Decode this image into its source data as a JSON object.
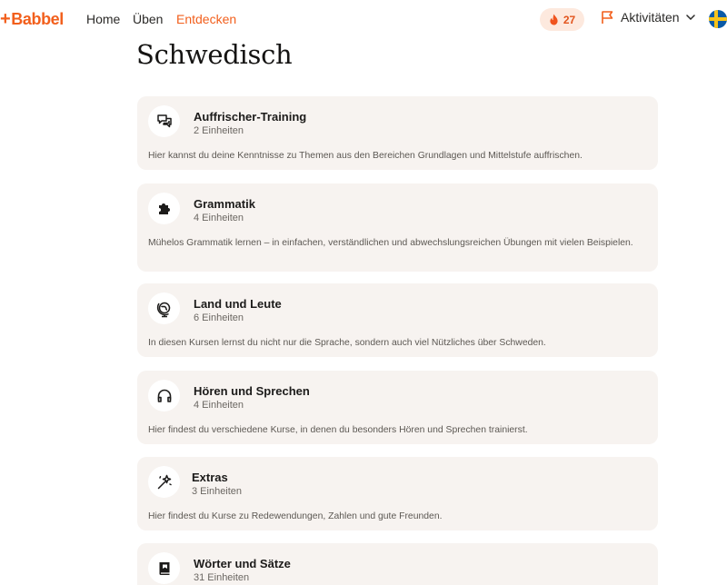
{
  "nav": {
    "logo": "Babbel",
    "links": [
      "Home",
      "Üben",
      "Entdecken"
    ],
    "active_link": "Entdecken",
    "streak_count": "27",
    "activities_label": "Aktivitäten",
    "language_flag": "flag-sweden-icon"
  },
  "colors": {
    "accent": "#f25f1c",
    "card_bg": "#f7f3f0",
    "streak_bg": "#fde9de"
  },
  "page_title": "Schwedisch",
  "categories": [
    {
      "title": "Auffrischer-Training",
      "units": "2 Einheiten",
      "description": "Hier kannst du deine Kenntnisse zu Themen aus den Bereichen Grundlagen und Mittelstufe auffrischen.",
      "icon": "speech-bubbles-icon"
    },
    {
      "title": "Grammatik",
      "units": "4 Einheiten",
      "description": "Mühelos Grammatik lernen – in einfachen, verständlichen und abwechslungsreichen Übungen mit vielen Beispielen.",
      "icon": "puzzle-icon"
    },
    {
      "title": "Land und Leute",
      "units": "6 Einheiten",
      "description": "In diesen Kursen lernst du nicht nur die Sprache, sondern auch viel Nützliches über Schweden.",
      "icon": "globe-icon"
    },
    {
      "title": "Hören und Sprechen",
      "units": "4 Einheiten",
      "description": "Hier findest du verschiedene Kurse, in denen du besonders Hören und Sprechen trainierst.",
      "icon": "headphones-icon"
    },
    {
      "title": "Extras",
      "units": "3 Einheiten",
      "description": "Hier findest du Kurse zu Redewendungen, Zahlen und gute Freunden.",
      "icon": "magic-wand-icon"
    },
    {
      "title": "Wörter und Sätze",
      "units": "31 Einheiten",
      "description": "",
      "icon": "book-icon"
    }
  ]
}
